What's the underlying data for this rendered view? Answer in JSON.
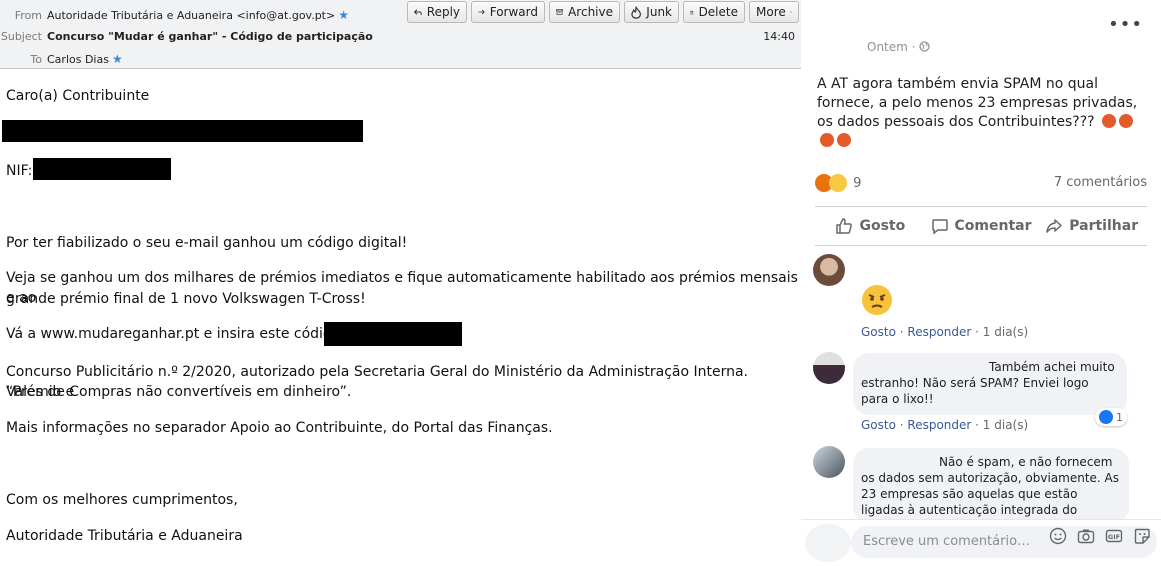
{
  "email": {
    "from_label": "From",
    "from_value": "Autoridade Tributária e Aduaneira <info@at.gov.pt>",
    "subject_label": "Subject",
    "subject_value": "Concurso \"Mudar é ganhar\" - Código de participação",
    "to_label": "To",
    "to_value": "Carlos Dias",
    "time": "14:40",
    "toolbar": {
      "reply": "Reply",
      "forward": "Forward",
      "archive": "Archive",
      "junk": "Junk",
      "delete": "Delete",
      "more": "More"
    },
    "body": {
      "greeting": "Caro(a) Contribuinte",
      "nif_label": "NIF:",
      "p1": "Por ter fiabilizado o seu e-mail ganhou um código digital!",
      "p2_line1": "Veja se ganhou um dos milhares de prémios imediatos e fique automaticamente habilitado aos prémios mensais e ao",
      "p2_line2": "grande prémio final de 1 novo Volkswagen T-Cross!",
      "p3": "Vá a www.mudareganhar.pt e insira este código:",
      "p4_line1": "Concurso Publicitário n.º 2/2020, autorizado pela Secretaria Geral do Ministério da Administração Interna. “Prémio e",
      "p4_line2": "Vales de Compras não convertíveis em dinheiro”.",
      "p5": "Mais informações no separador Apoio ao Contribuinte, do Portal das Finanças.",
      "closing": "Com os melhores cumprimentos,",
      "signature": "Autoridade Tributária e Aduaneira"
    }
  },
  "facebook": {
    "post_time": "Ontem",
    "post_text": "A AT agora também envia SPAM no qual fornece, a pelo menos 23 empresas privadas, os dados pessoais dos Contribuintes???",
    "reaction_count": "9",
    "comments_count": "7 comentários",
    "actions": {
      "like": "Gosto",
      "comment": "Comentar",
      "share": "Partilhar"
    },
    "comments": [
      {
        "text": "",
        "like": "Gosto",
        "reply": "Responder",
        "time": "1 dia(s)"
      },
      {
        "text": "Também achei muito estranho! Não será SPAM? Enviei logo para o lixo!!",
        "like": "Gosto",
        "reply": "Responder",
        "time": "1 dia(s)",
        "reactions": "1"
      },
      {
        "text": "Não é spam, e não fornecem os dados sem autorização, obviamente. As 23 empresas são aquelas que estão ligadas à autenticação integrada do estado e que,"
      }
    ],
    "composer_placeholder": "Escreve um comentário…"
  },
  "colors": {
    "link": "#385898",
    "header_bg": "#f1f2f4",
    "angry": "#e55a2b"
  }
}
